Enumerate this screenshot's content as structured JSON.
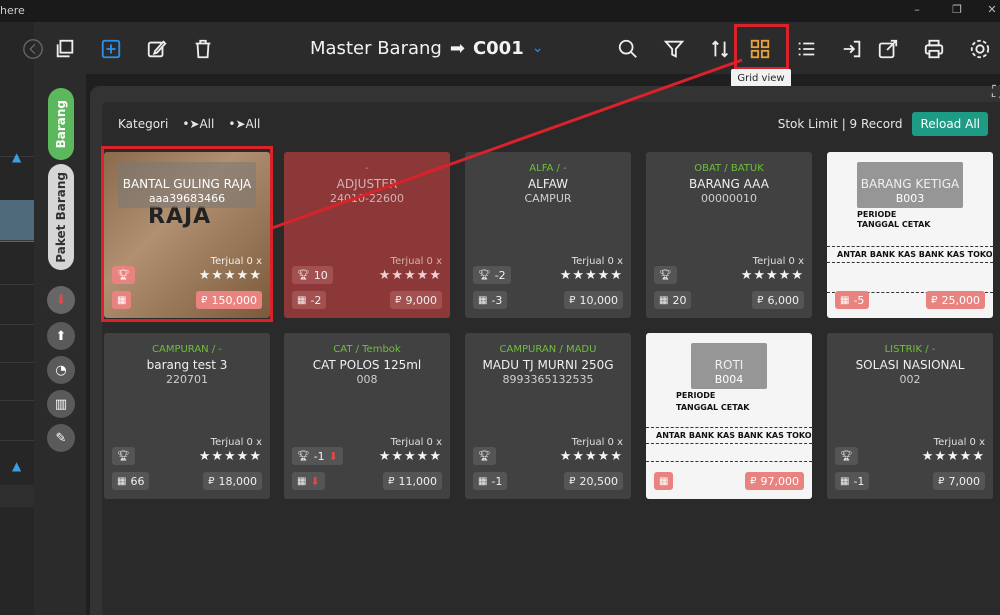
{
  "window": {
    "title_fragment": "here"
  },
  "toolbar": {
    "title": "Master Barang",
    "code": "C001",
    "icons": [
      "copy-icon",
      "add-icon",
      "edit-icon",
      "delete-icon",
      "search-icon",
      "filter-icon",
      "sort-icon",
      "grid-view-icon",
      "list-view-icon",
      "import-icon",
      "export-icon",
      "print-icon",
      "settings-icon"
    ],
    "tooltip": "Grid view"
  },
  "sidebar": {
    "tabs": [
      {
        "label": "Barang",
        "color": "#5cb85c"
      },
      {
        "label": "Paket Barang",
        "color": "#d0d0d0"
      }
    ]
  },
  "filter": {
    "kategori_label": "Kategori",
    "all1": "All",
    "all2": "All",
    "summary": "Stok Limit | 9 Record",
    "reload": "Reload All"
  },
  "colors": {
    "accent_green": "#1e9b84",
    "highlight_red": "#d9222a",
    "category_green": "#6fbf3c"
  },
  "cards": [
    {
      "category": "",
      "name": "BANTAL GULING RAJA",
      "code": "aaa39683466",
      "sold": "Terjual 0 x",
      "trophy": "",
      "stock": "",
      "price": "150,000"
    },
    {
      "category": "-",
      "name": "ADJUSTER",
      "code": "24010-22600",
      "sold": "Terjual 0 x",
      "trophy": "10",
      "stock": "-2",
      "price": "9,000"
    },
    {
      "category": "ALFA / -",
      "name": "ALFAW",
      "code": "CAMPUR",
      "sold": "Terjual 0 x",
      "trophy": "-2",
      "stock": "-3",
      "price": "10,000"
    },
    {
      "category": "OBAT / BATUK",
      "name": "BARANG AAA",
      "code": "00000010",
      "sold": "Terjual 0 x",
      "trophy": "",
      "stock": "20",
      "price": "6,000"
    },
    {
      "category": "",
      "name": "BARANG KETIGA",
      "code": "B003",
      "sold": "",
      "trophy": "",
      "stock": "-5",
      "price": "25,000"
    },
    {
      "category": "CAMPURAN / -",
      "name": "barang test 3",
      "code": "220701",
      "sold": "Terjual 0 x",
      "trophy": "",
      "stock": "66",
      "price": "18,000"
    },
    {
      "category": "CAT / Tembok",
      "name": "CAT POLOS 125ml",
      "code": "008",
      "sold": "Terjual 0 x",
      "trophy": "-1",
      "stock": "",
      "price": "11,000"
    },
    {
      "category": "CAMPURAN / MADU",
      "name": "MADU TJ MURNI 250G",
      "code": "8993365132535",
      "sold": "Terjual 0 x",
      "trophy": "",
      "stock": "-1",
      "price": "20,500"
    },
    {
      "category": "",
      "name": "ROTI",
      "code": "B004",
      "sold": "",
      "trophy": "",
      "stock": "",
      "price": "97,000"
    },
    {
      "category": "LISTRIK / -",
      "name": "SOLASI NASIONAL",
      "code": "002",
      "sold": "Terjual 0 x",
      "trophy": "",
      "stock": "-1",
      "price": "7,000"
    }
  ],
  "stars": "★★★★★",
  "image_text": {
    "raja": "RAJA"
  }
}
